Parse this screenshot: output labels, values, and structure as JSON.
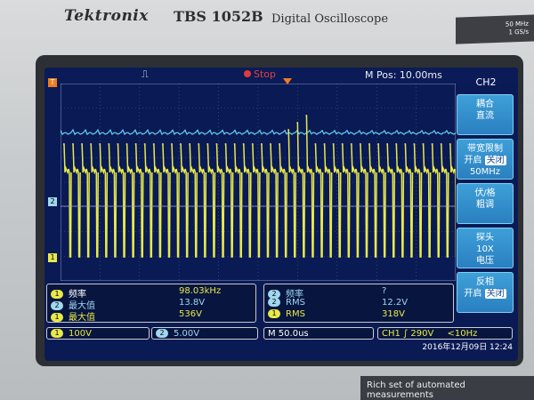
{
  "device": {
    "brand": "Tektronix",
    "model": "TBS 1052B",
    "description": "Digital Oscilloscope",
    "spec_line1": "50 MHz",
    "spec_line2": "1 GS/s",
    "bottom_label": "Rich set of automated measurements"
  },
  "topbar": {
    "trigger_icon": "trigger-pulse-icon",
    "state": "Stop",
    "m_pos": "M Pos: 10.00ms"
  },
  "markers": {
    "trigger_marker": "T",
    "ch2_marker": "2",
    "ch1_marker": "1"
  },
  "side_menu": {
    "title": "CH2",
    "buttons": [
      {
        "line1": "耦合",
        "line2": "直流",
        "line3": ""
      },
      {
        "line1": "带宽限制",
        "line2_prefix": "开启",
        "line2_selected": "关闭",
        "line3": "50MHz"
      },
      {
        "line1": "伏/格",
        "line2": "粗调",
        "line3": ""
      },
      {
        "line1": "探头",
        "line2": "10X",
        "line3": "电压"
      },
      {
        "line1": "反相",
        "line2_prefix": "开启",
        "line2_selected": "关闭",
        "line3": ""
      }
    ]
  },
  "measurements_left": [
    {
      "ch": "1",
      "name": "频率",
      "value": "98.03kHz"
    },
    {
      "ch": "2",
      "name": "最大值",
      "value": "13.8V"
    },
    {
      "ch": "1",
      "name": "最大值",
      "value": "536V"
    }
  ],
  "measurements_right": [
    {
      "ch": "2",
      "name": "频率",
      "value": "?"
    },
    {
      "ch": "2",
      "name": "RMS",
      "value": "12.2V"
    },
    {
      "ch": "1",
      "name": "RMS",
      "value": "318V"
    }
  ],
  "status": {
    "ch1_num": "1",
    "ch1_scale": "100V",
    "ch2_num": "2",
    "ch2_scale": "5.00V",
    "timebase": "M 50.0us",
    "trigger": "CH1 ∫ 290V",
    "trigger_freq": "<10Hz",
    "datetime": "2016年12月09日 12:24"
  },
  "colors": {
    "ch1": "#e8e94a",
    "ch2": "#5fd0ee",
    "screen_bg": "#0a1a55",
    "grid": "#5c6a9a",
    "menu_button": "#2a7fc0"
  }
}
